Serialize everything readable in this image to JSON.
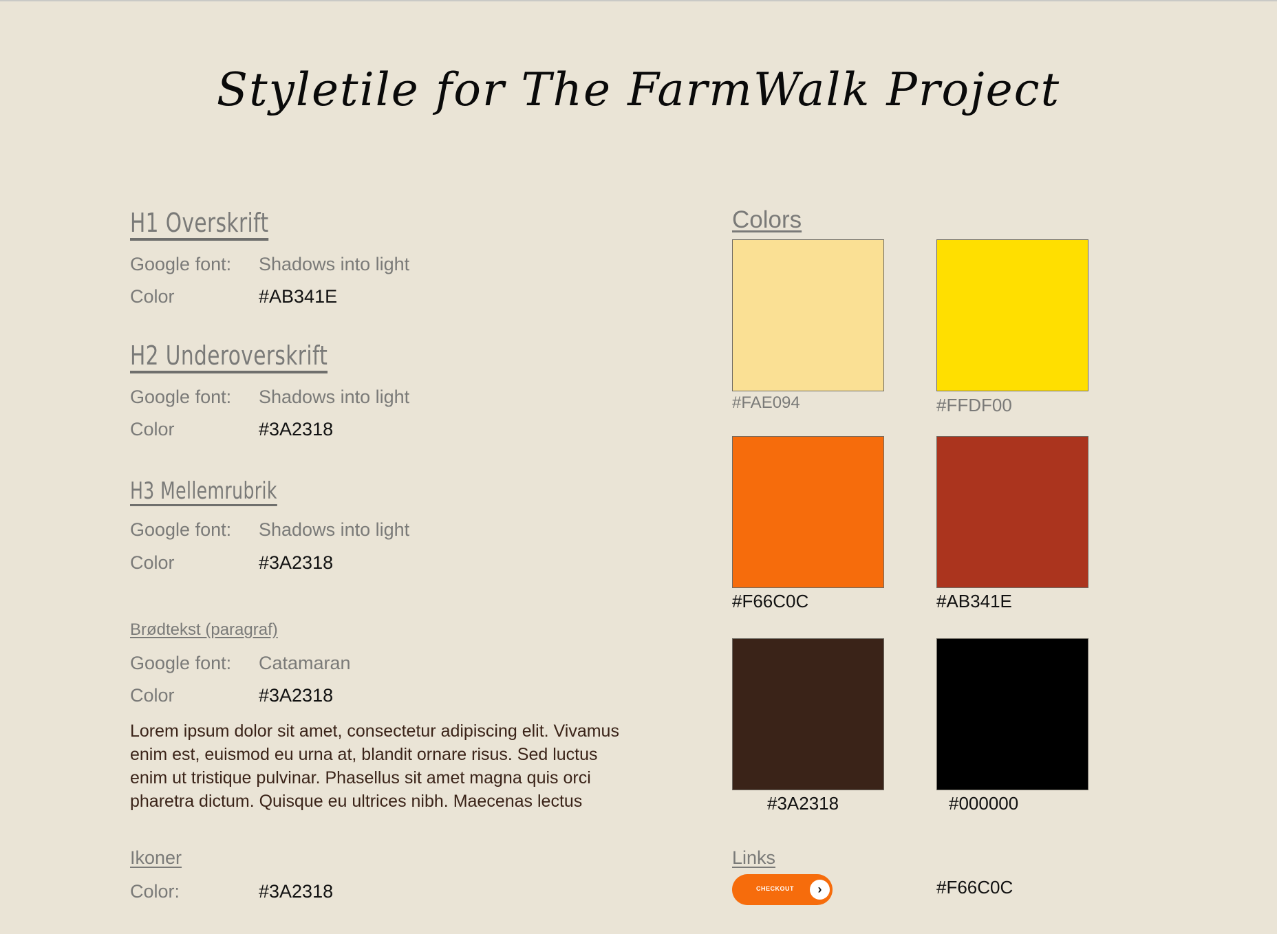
{
  "title": "Styletile for The FarmWalk Project",
  "typography": [
    {
      "heading": "H1 Overskrift",
      "font_label": "Google font:",
      "font_value": "Shadows into light",
      "color_label": "Color",
      "color_value": "#AB341E"
    },
    {
      "heading": "H2 Underoverskrift",
      "font_label": "Google font:",
      "font_value": "Shadows into light",
      "color_label": "Color",
      "color_value": "#3A2318"
    },
    {
      "heading": "H3 Mellemrubrik",
      "font_label": "Google font:",
      "font_value": "Shadows into light",
      "color_label": "Color",
      "color_value": "#3A2318"
    },
    {
      "heading": "Brødtekst (paragraf)",
      "font_label": "Google font:",
      "font_value": "Catamaran",
      "color_label": "Color",
      "color_value": "#3A2318"
    }
  ],
  "paragraph": "Lorem ipsum dolor sit amet, consectetur adipiscing elit. Vivamus enim est, euismod eu urna at, blandit ornare risus. Sed luctus enim ut tristique pulvinar. Phasellus sit amet magna quis orci pharetra dictum. Quisque eu ultrices nibh. Maecenas lectus",
  "icons": {
    "heading": "Ikoner",
    "color_label": "Color:",
    "color_value": "#3A2318"
  },
  "colors": {
    "heading": "Colors",
    "swatches": [
      {
        "label": "#FAE094",
        "hex": "#FAE094"
      },
      {
        "label": "#FFDF00",
        "hex": "#FFDF00"
      },
      {
        "label": "#F66C0C",
        "hex": "#F66C0C"
      },
      {
        "label": "#AB341E",
        "hex": "#AB341E"
      },
      {
        "label": "#3A2318",
        "hex": "#3A2318"
      },
      {
        "label": "#000000",
        "hex": "#000000"
      }
    ]
  },
  "links": {
    "heading": "Links",
    "button_label": "CHECKOUT",
    "button_icon": "chevron-right-icon",
    "color_value": "#F66C0C"
  }
}
